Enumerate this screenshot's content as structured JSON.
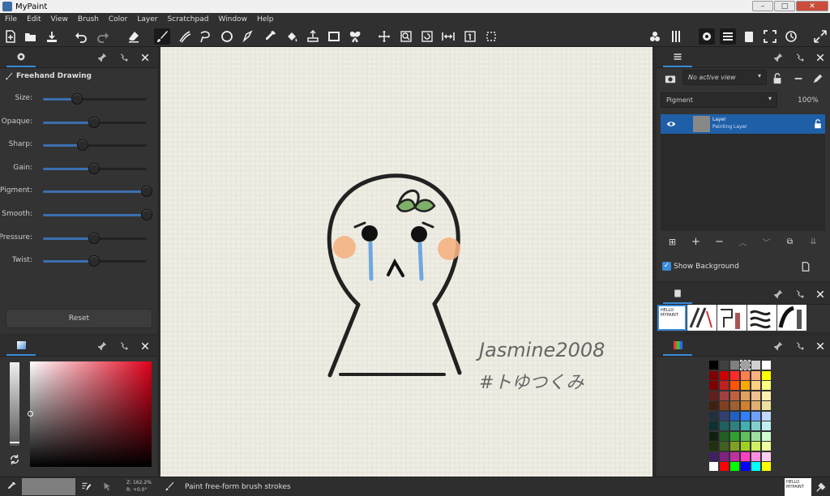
{
  "window": {
    "title": "MyPaint"
  },
  "menubar": [
    "File",
    "Edit",
    "View",
    "Brush",
    "Color",
    "Layer",
    "Scratchpad",
    "Window",
    "Help"
  ],
  "tool_options": {
    "tool_name": "Freehand Drawing",
    "sliders": [
      {
        "label": "Size:",
        "value": 0.33
      },
      {
        "label": "Opaque:",
        "value": 0.49
      },
      {
        "label": "Sharp:",
        "value": 0.38
      },
      {
        "label": "Gain:",
        "value": 0.49
      },
      {
        "label": "Pigment:",
        "value": 1.0
      },
      {
        "label": "Smooth:",
        "value": 1.0
      },
      {
        "label": "Pressure:",
        "value": 0.49
      },
      {
        "label": "Twist:",
        "value": 0.49
      }
    ],
    "reset_label": "Reset"
  },
  "layers": {
    "view_placeholder": "No active view",
    "mode": "Pigment",
    "opacity": "100%",
    "layer_name": "Layer",
    "layer_type": "Painting Layer",
    "show_background_label": "Show Background",
    "show_background_checked": true
  },
  "canvas": {
    "signature_line1": "Jasmine2008",
    "signature_line2": "#トゆつくみ"
  },
  "status": {
    "zoom": "Z: 162.2%",
    "rotation": "R: +0.0°",
    "message": "Paint free-form brush strokes"
  },
  "brush_thumbnail_text": "HELLO MYPAINT",
  "colors": {
    "accent": "#3b8bd9",
    "layer_selected": "#1e5fa8",
    "canvas_bg": "#efeee4",
    "panel_bg": "#333333"
  },
  "palette": [
    [
      "#000000",
      "#404040",
      "#808080",
      "#a0a0a0",
      "#d0d0d0",
      "#ffffff"
    ],
    [
      "#7f0000",
      "#cc0000",
      "#ff2a2a",
      "#ff7f50",
      "#ffb080",
      "#ffff00"
    ],
    [
      "#800000",
      "#c02020",
      "#ff5500",
      "#ffaa00",
      "#ffd080",
      "#ffff80"
    ],
    [
      "#602020",
      "#a04040",
      "#c06040",
      "#e0a060",
      "#f0c090",
      "#fff0b0"
    ],
    [
      "#402010",
      "#804020",
      "#a06030",
      "#d08030",
      "#e0b070",
      "#f0e0a0"
    ],
    [
      "#203040",
      "#304070",
      "#2060c0",
      "#3080ff",
      "#70a0ff",
      "#c0d8ff"
    ],
    [
      "#103030",
      "#206060",
      "#308080",
      "#40b0b0",
      "#80d0d0",
      "#c0f0f0"
    ],
    [
      "#102010",
      "#206020",
      "#30a030",
      "#60c060",
      "#a0e0a0",
      "#d0ffd0"
    ],
    [
      "#203010",
      "#406020",
      "#80a020",
      "#a0d020",
      "#d0f060",
      "#f0ffa0"
    ],
    [
      "#402060",
      "#802080",
      "#c030a0",
      "#ff40c0",
      "#ff90e0",
      "#ffd0f0"
    ],
    [
      "#ffffff",
      "#ff0000",
      "#00ff00",
      "#0000ff",
      "#00ffff",
      "#ffff00"
    ]
  ]
}
